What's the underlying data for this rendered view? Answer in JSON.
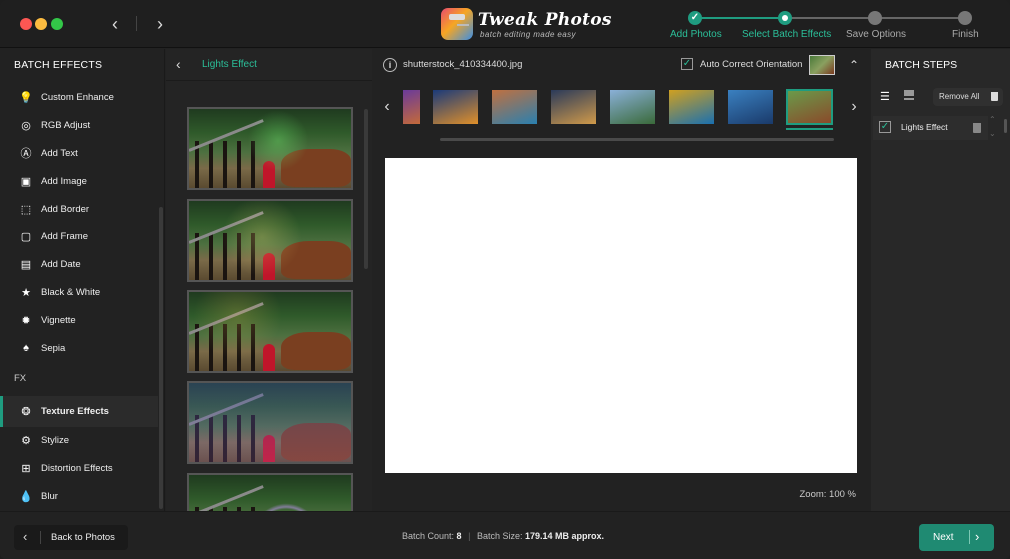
{
  "titlebar": {
    "back_glyph": "‹",
    "forward_glyph": "›",
    "brand": "Tweak Photos",
    "tagline": "batch editing made easy",
    "steps": [
      {
        "label": "Add Photos",
        "state": "done"
      },
      {
        "label": "Select Batch Effects",
        "state": "current"
      },
      {
        "label": "Save Options",
        "state": "pending"
      },
      {
        "label": "Finish",
        "state": "pending"
      }
    ]
  },
  "sidebar": {
    "title": "BATCH EFFECTS",
    "items": [
      {
        "label": "Custom Enhance",
        "icon": "bulb-icon",
        "glyph": "💡"
      },
      {
        "label": "RGB Adjust",
        "icon": "rgb-icon",
        "glyph": "◎"
      },
      {
        "label": "Add Text",
        "icon": "text-icon",
        "glyph": "Ⓐ"
      },
      {
        "label": "Add Image",
        "icon": "image-icon",
        "glyph": "▣"
      },
      {
        "label": "Add Border",
        "icon": "border-icon",
        "glyph": "⬚"
      },
      {
        "label": "Add Frame",
        "icon": "frame-icon",
        "glyph": "▢"
      },
      {
        "label": "Add Date",
        "icon": "calendar-icon",
        "glyph": "▤"
      },
      {
        "label": "Black & White",
        "icon": "star-icon",
        "glyph": "★"
      },
      {
        "label": "Vignette",
        "icon": "vignette-icon",
        "glyph": "✹"
      },
      {
        "label": "Sepia",
        "icon": "sepia-icon",
        "glyph": "♠"
      }
    ],
    "fx_section": "FX",
    "fx_items": [
      {
        "label": "Texture Effects",
        "icon": "texture-icon",
        "glyph": "❂",
        "active": true
      },
      {
        "label": "Stylize",
        "icon": "stylize-icon",
        "glyph": "⚙"
      },
      {
        "label": "Distortion Effects",
        "icon": "distortion-icon",
        "glyph": "⊞"
      },
      {
        "label": "Blur",
        "icon": "blur-icon",
        "glyph": "💧"
      }
    ]
  },
  "effects_panel": {
    "back_glyph": "‹",
    "title": "Lights Effect",
    "thumbnail_count": 5
  },
  "center": {
    "info_glyph": "i",
    "filename": "shutterstock_410334400.jpg",
    "auto_correct_label": "Auto Correct Orientation",
    "auto_correct_checked": true,
    "check_glyph": "✓",
    "collapse_glyph": "⌃",
    "strip_prev": "‹",
    "strip_next": "›",
    "strip_thumbnails": [
      {
        "name": "city-purple",
        "colors": [
          "#6a3a9a",
          "#c46a3a"
        ]
      },
      {
        "name": "city-night-highway",
        "colors": [
          "#1a3a7a",
          "#e0902a"
        ]
      },
      {
        "name": "city-skyscrapers-dusk",
        "colors": [
          "#c07040",
          "#2a80b0"
        ]
      },
      {
        "name": "city-aerial-night",
        "colors": [
          "#2a3a5a",
          "#d09a4a"
        ]
      },
      {
        "name": "city-skyline-day",
        "colors": [
          "#8ab0d8",
          "#3a6a3a"
        ]
      },
      {
        "name": "autumn-lake",
        "colors": [
          "#d0a020",
          "#1a70b0"
        ]
      },
      {
        "name": "mountain-lake",
        "colors": [
          "#3a80c0",
          "#1a3a6a"
        ]
      },
      {
        "name": "girl-horse-fence",
        "colors": [
          "#6a9a4a",
          "#8a4a2a"
        ],
        "selected": true
      }
    ],
    "zoom_label": "Zoom: 100 %"
  },
  "right": {
    "title": "BATCH STEPS",
    "list_glyph": "☰",
    "remove_all_label": "Remove  All",
    "steps": [
      {
        "label": "Lights Effect",
        "checked": true
      }
    ],
    "up_glyph": "⌃",
    "down_glyph": "⌄"
  },
  "footer": {
    "back_label": "Back to Photos",
    "back_glyph": "‹",
    "batch_count_label": "Batch Count:",
    "batch_count": "8",
    "divider": "|",
    "batch_size_label": "Batch Size:",
    "batch_size": "179.14 MB approx.",
    "next_label": "Next",
    "next_glyph": "›"
  },
  "colors": {
    "accent": "#1f9c80",
    "accent_text": "#2bbf99",
    "background": "#222222"
  }
}
